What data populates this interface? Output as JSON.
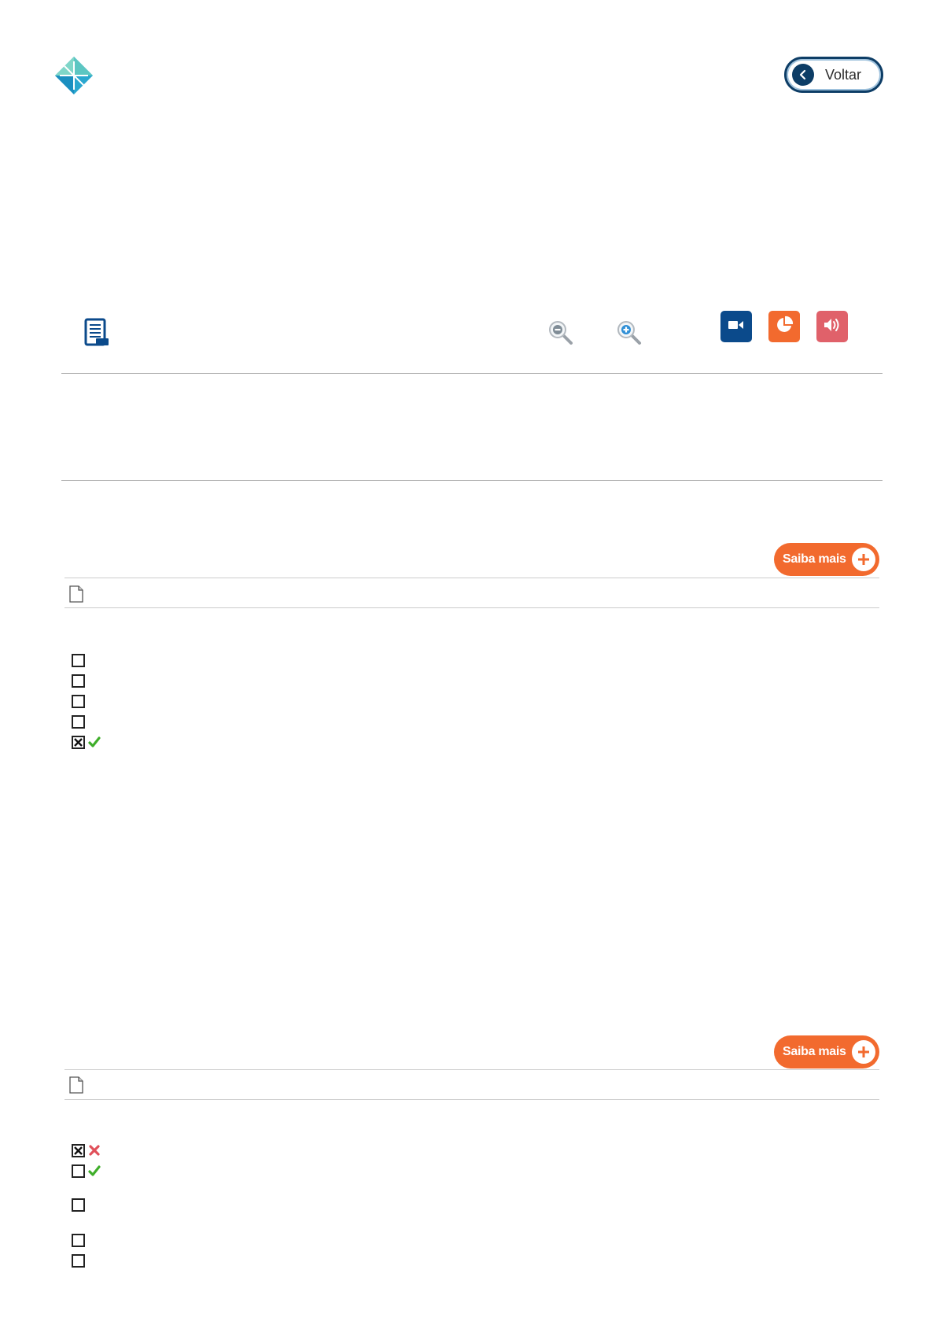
{
  "header": {
    "logo_icon": "diamond-logo-icon",
    "back_label": "Voltar"
  },
  "toolbar": {
    "icons": [
      "list-document-icon",
      "zoom-out-icon",
      "zoom-in-icon",
      "video-icon",
      "chart-icon",
      "speaker-icon"
    ],
    "colors": {
      "video": "#0b4a8b",
      "chart": "#f26a2e",
      "audio": "#e0616a"
    }
  },
  "questions": [
    {
      "saiba_mais_label": "Saiba mais",
      "options": [
        {
          "checked": false,
          "feedback": "none"
        },
        {
          "checked": false,
          "feedback": "none"
        },
        {
          "checked": false,
          "feedback": "none"
        },
        {
          "checked": false,
          "feedback": "none"
        },
        {
          "checked": true,
          "feedback": "correct"
        }
      ]
    },
    {
      "saiba_mais_label": "Saiba mais",
      "options": [
        {
          "checked": true,
          "feedback": "wrong"
        },
        {
          "checked": false,
          "feedback": "correct"
        },
        {
          "checked": false,
          "feedback": "none"
        },
        {
          "checked": false,
          "feedback": "none"
        },
        {
          "checked": false,
          "feedback": "none"
        }
      ]
    }
  ],
  "colors": {
    "accent": "#f26a2e",
    "brand": "#0d3d66",
    "correct": "#3fae2a",
    "wrong": "#e0505a"
  }
}
